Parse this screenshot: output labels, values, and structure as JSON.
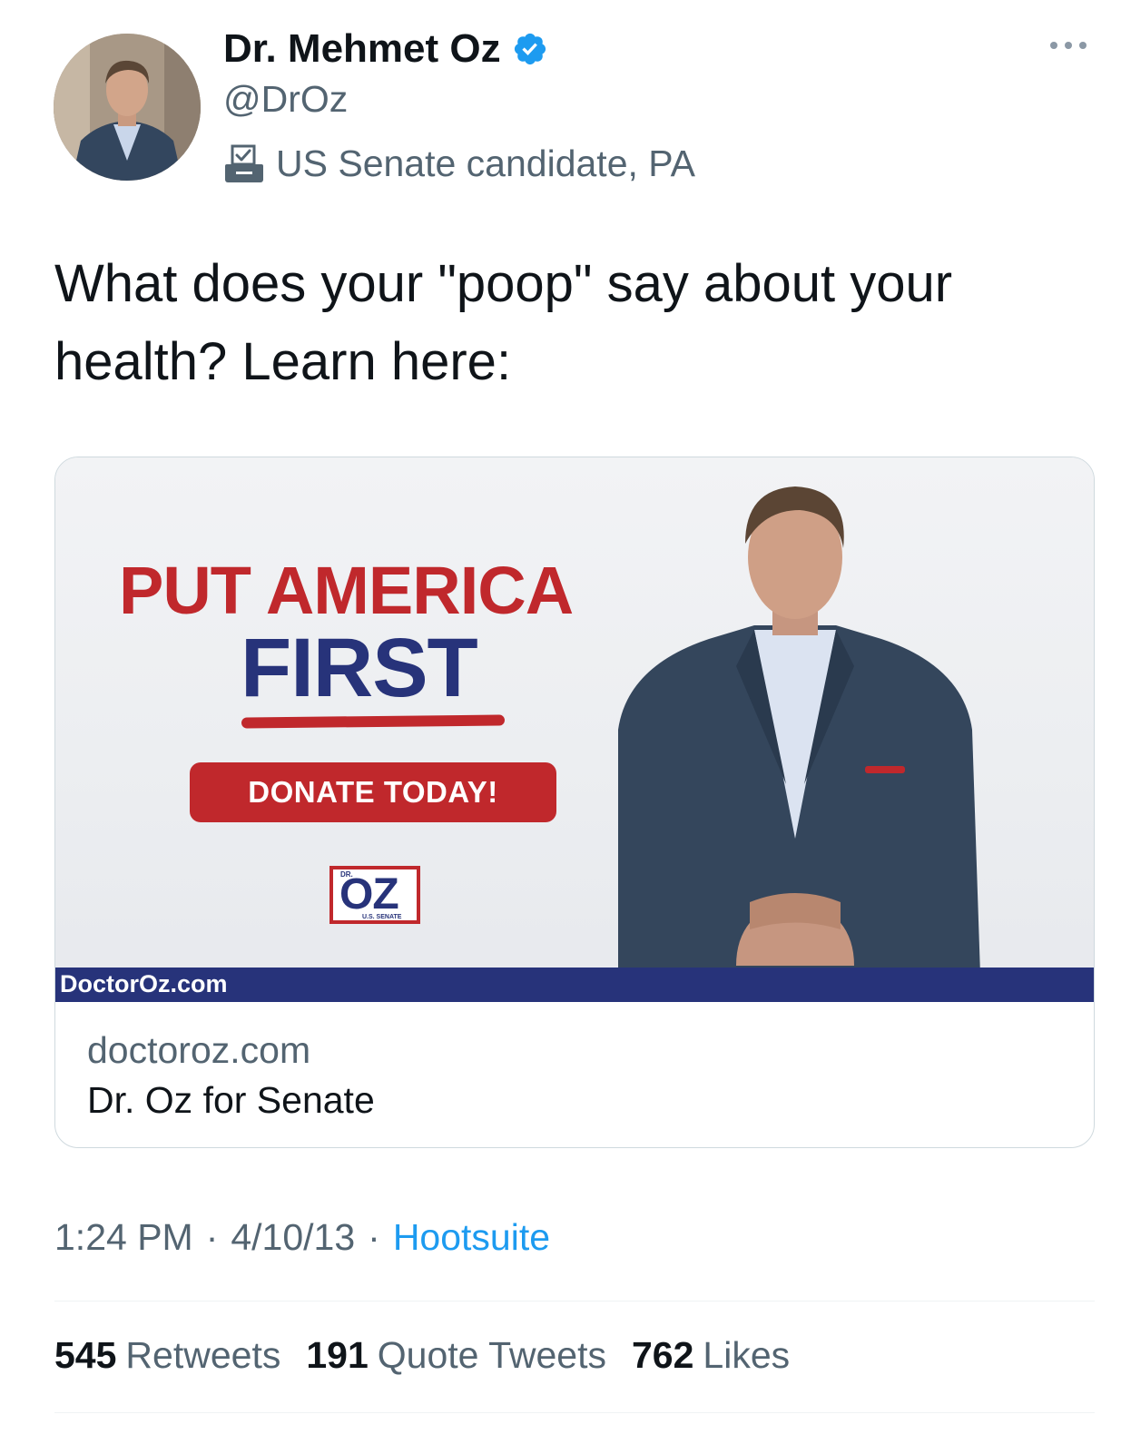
{
  "author": {
    "name": "Dr. Mehmet Oz",
    "handle": "@DrOz",
    "verified": true,
    "label": "US Senate candidate, PA",
    "label_icon": "ballot-box-icon"
  },
  "tweet": {
    "text": "What does your \"poop\" say about your health? Learn here:"
  },
  "card": {
    "headline_line1": "PUT AMERICA",
    "headline_line2": "FIRST",
    "cta": "DONATE TODAY!",
    "logo_small": "DR.",
    "logo_big": "OZ",
    "logo_sub": "U.S. SENATE",
    "media_bar_text": "DoctorOz.com",
    "domain": "doctoroz.com",
    "title": "Dr. Oz for Senate"
  },
  "meta": {
    "time": "1:24 PM",
    "separator": "·",
    "date": "4/10/13",
    "source": "Hootsuite"
  },
  "stats": [
    {
      "count": "545",
      "label": "Retweets"
    },
    {
      "count": "191",
      "label": "Quote Tweets"
    },
    {
      "count": "762",
      "label": "Likes"
    }
  ],
  "colors": {
    "brand_blue": "#1d9bf0",
    "campaign_red": "#c0282c",
    "campaign_navy": "#27337a",
    "secondary_text": "#536471"
  }
}
